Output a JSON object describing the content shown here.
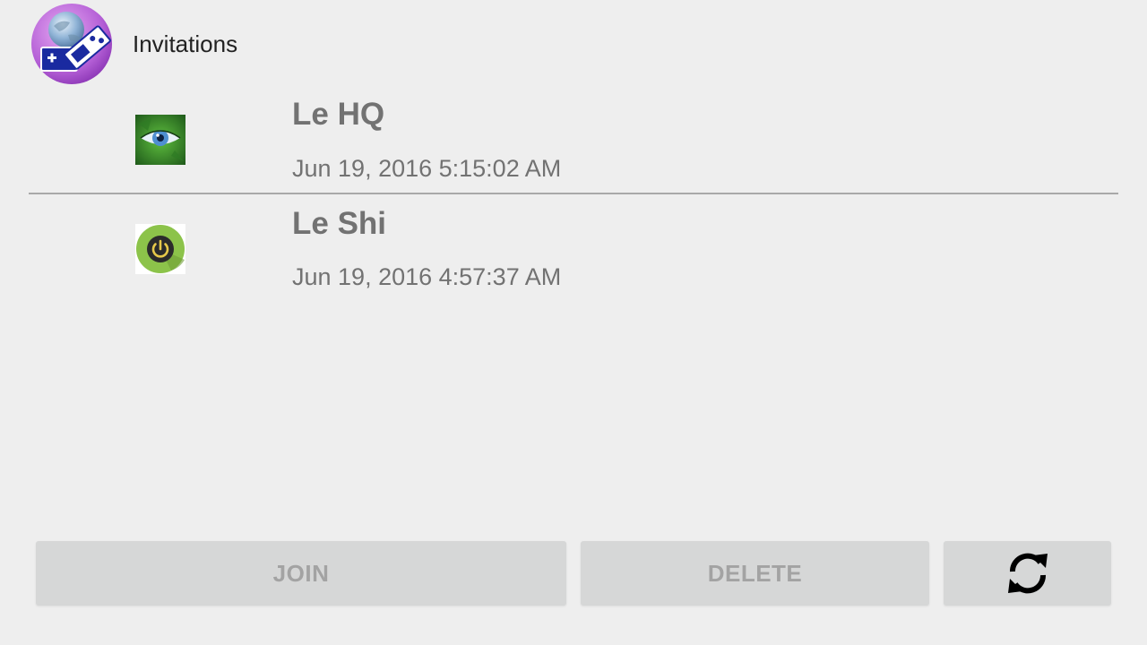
{
  "header": {
    "title": "Invitations",
    "logo_icon": "globe-gamepad-icon"
  },
  "invitations": [
    {
      "name": "Le HQ",
      "date": "Jun 19, 2016 5:15:02 AM",
      "avatar_icon": "eye-icon"
    },
    {
      "name": "Le Shi",
      "date": "Jun 19, 2016 4:57:37 AM",
      "avatar_icon": "power-icon"
    }
  ],
  "actions": {
    "join_label": "JOIN",
    "delete_label": "DELETE",
    "refresh_icon": "refresh-icon"
  },
  "colors": {
    "background": "#eeeeee",
    "button_bg": "#d6d7d7",
    "button_text_disabled": "#a3a3a3",
    "list_text": "#727272",
    "divider": "#a8a8a8"
  }
}
